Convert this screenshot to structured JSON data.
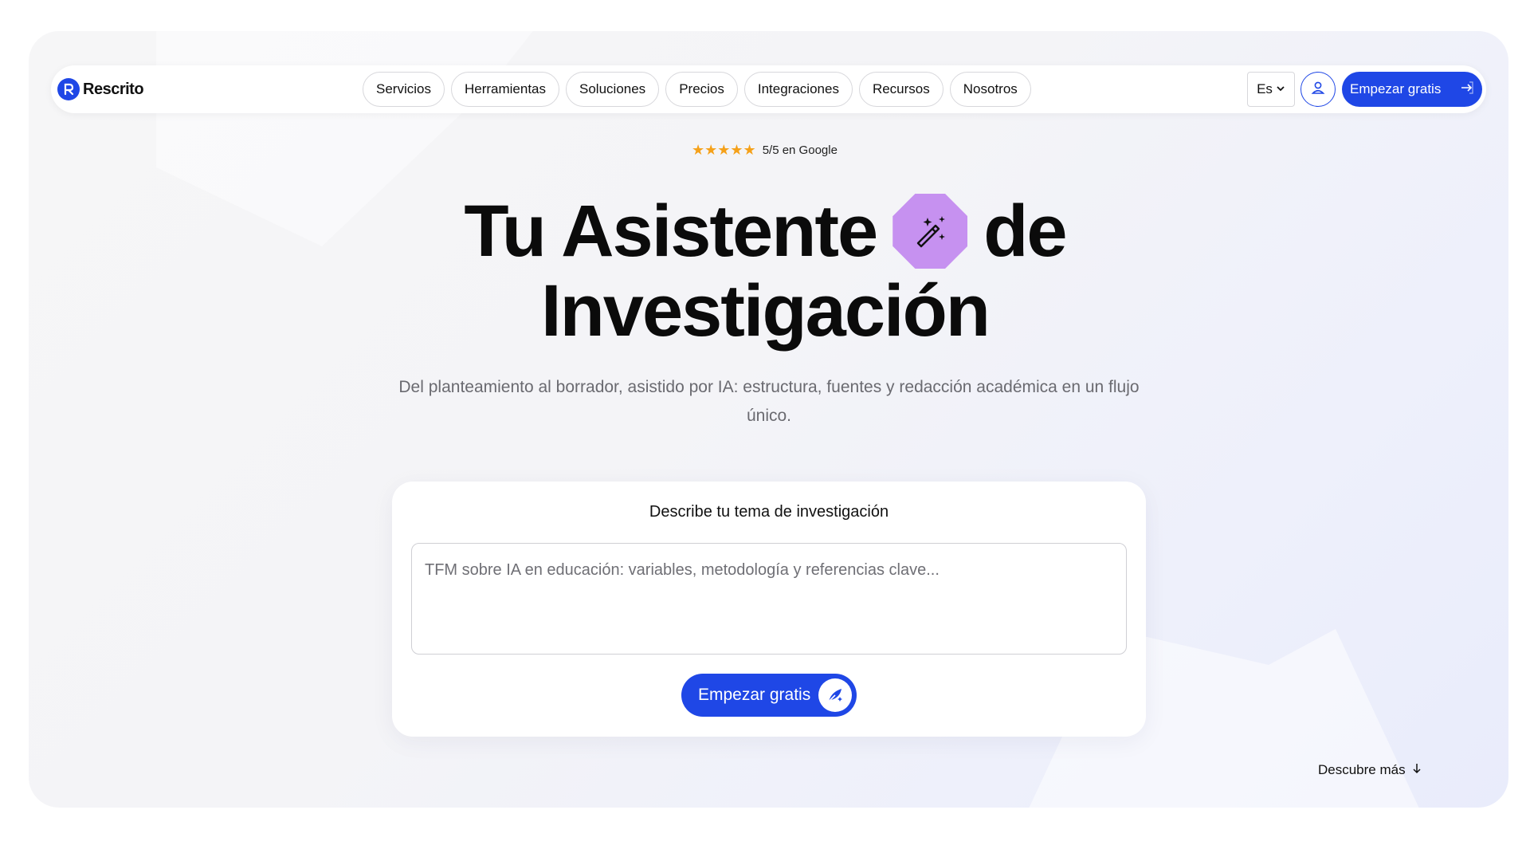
{
  "brand": {
    "name": "Rescrito",
    "color": "#1f47e6"
  },
  "nav": {
    "items": [
      "Servicios",
      "Herramientas",
      "Soluciones",
      "Precios",
      "Integraciones",
      "Recursos",
      "Nosotros"
    ],
    "language": "Es",
    "cta": "Empezar gratis"
  },
  "rating": {
    "stars": 5,
    "text": "5/5 en Google"
  },
  "hero": {
    "title_line1_a": "Tu Asistente",
    "title_line1_b": "de",
    "title_line2": "Investigación",
    "subtitle": "Del planteamiento al borrador, asistido por IA: estructura, fuentes y redacción académica en un flujo único."
  },
  "form": {
    "heading": "Describe tu tema de investigación",
    "placeholder": "TFM sobre IA en educación: variables, metodología y referencias clave...",
    "value": "",
    "submit": "Empezar gratis"
  },
  "footer_hint": {
    "label": "Descubre más"
  },
  "icons": {
    "magic": "magic-wand-icon",
    "user": "user-icon",
    "arrow": "arrow-right-icon",
    "down": "arrow-down-icon"
  },
  "colors": {
    "accent": "#1f47e6",
    "star": "#f5a11a",
    "magic_bg": "#c691f0"
  }
}
